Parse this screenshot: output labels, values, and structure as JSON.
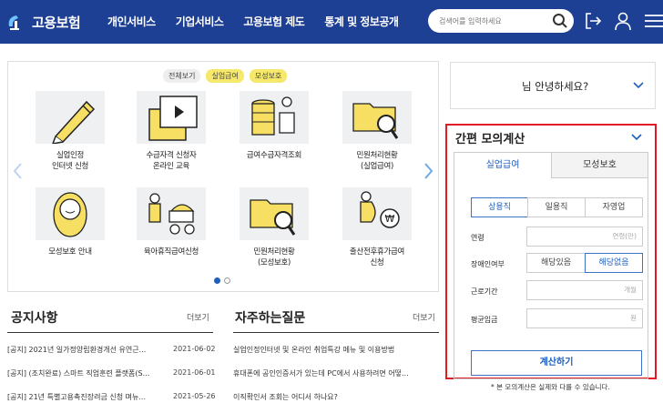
{
  "header": {
    "logo_text": "고용보험",
    "nav": [
      "개인서비스",
      "기업서비스",
      "고용보험 제도",
      "통계 및 정보공개"
    ],
    "search_placeholder": "검색어를 입력하세요"
  },
  "services": {
    "filters": [
      "전체보기",
      "실업급여",
      "모성보호"
    ],
    "tiles": [
      {
        "label": "실업인정\n인터넷 신청",
        "icon": "pencil-icon"
      },
      {
        "label": "수급자격 신청자\n온라인 교육",
        "icon": "video-folder-icon"
      },
      {
        "label": "급여수급자격조회",
        "icon": "coins-person-icon"
      },
      {
        "label": "민원처리현황\n(실업급여)",
        "icon": "folder-search-icon"
      },
      {
        "label": "모성보호 안내",
        "icon": "baby-icon"
      },
      {
        "label": "육아휴직급여신청",
        "icon": "stroller-icon"
      },
      {
        "label": "민원처리현황\n(모성보호)",
        "icon": "folder-search-icon"
      },
      {
        "label": "출산전후휴가급여\n신청",
        "icon": "pregnant-won-icon"
      }
    ]
  },
  "notices": {
    "title": "공지사항",
    "more": "더보기",
    "items": [
      {
        "text": "[공지] 2021년 일가정양립환경개선 유연근...",
        "date": "2021-06-02"
      },
      {
        "text": "[공지] (조치완료) 스마트 직업훈련 플랫폼(S...",
        "date": "2021-06-01"
      },
      {
        "text": "[공지] 21년 특별고용촉진장려금 신청 며뉴...",
        "date": "2021-05-26"
      }
    ]
  },
  "faq": {
    "title": "자주하는질문",
    "more": "더보기",
    "items": [
      "실업인정인터넷 및 온라인 취업특강 메뉴 및 이용방법",
      "휴대폰에 공인인증서가 있는데 PC에서 사용하려면 어떻...",
      "이직확인서 조회는 어디서 하나요?"
    ]
  },
  "greeting": {
    "text": "님 안녕하세요?"
  },
  "calculator": {
    "title": "간편 모의계산",
    "tabs": [
      "실업급여",
      "모성보호"
    ],
    "employment_types": [
      "상용직",
      "일용직",
      "자영업"
    ],
    "labels": {
      "age": "연령",
      "disability": "장애인여부",
      "period": "근로기간",
      "wage": "평균임금"
    },
    "age_unit": "연령(만)",
    "disability_options": [
      "해당있음",
      "해당없음"
    ],
    "period_unit": "개월",
    "wage_unit": "원",
    "submit": "계산하기",
    "note": "* 본 모의계산은 실제와 다를 수 있습니다."
  },
  "colors": {
    "brand": "#1d3f94",
    "accent": "#1d5fbf",
    "highlight": "#e01b24",
    "chip_yellow": "#f6e86a"
  }
}
